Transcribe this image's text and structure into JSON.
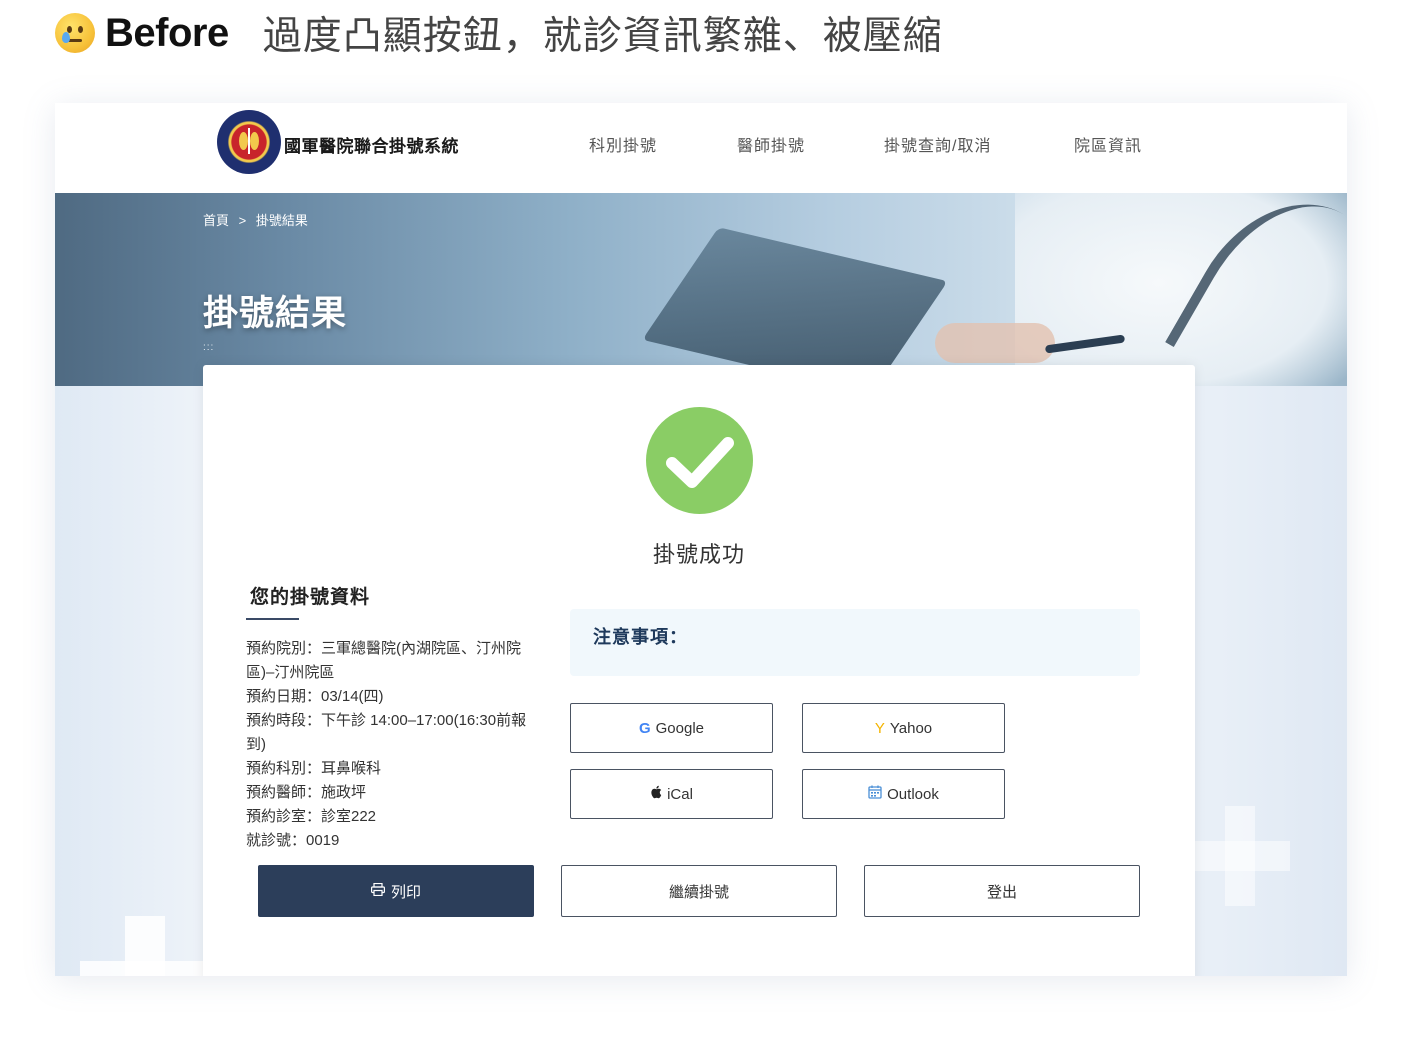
{
  "caption": {
    "emoji": "sad-tear-face",
    "before": "Before",
    "description": "過度凸顯按鈕，就診資訊繁雜、被壓縮"
  },
  "nav": {
    "brand": "國軍醫院聯合掛號系統",
    "items": [
      "科別掛號",
      "醫師掛號",
      "掛號查詢/取消",
      "院區資訊"
    ]
  },
  "hero": {
    "breadcrumb": [
      "首頁",
      ">",
      "掛號結果"
    ],
    "title": "掛號結果",
    "dots": ":::"
  },
  "result": {
    "status": "掛號成功"
  },
  "info": {
    "title": "您的掛號資料",
    "lines": [
      "預約院別：三軍總醫院(內湖院區、汀州院區)–汀州院區",
      "預約日期：03/14(四)",
      "預約時段：下午診 14:00–17:00(16:30前報到)",
      "預約科別：耳鼻喉科",
      "預約醫師：施政坪",
      "預約診室：診室222",
      "就診號：0019"
    ]
  },
  "notice": {
    "title": "注意事項："
  },
  "calendar": {
    "google": "Google",
    "yahoo": "Yahoo",
    "ical": "iCal",
    "outlook": "Outlook"
  },
  "actions": {
    "print": "列印",
    "continue": "繼續掛號",
    "logout": "登出"
  },
  "colors": {
    "primary": "#2c3e5a",
    "success": "#8acd65",
    "google": "#4285f4",
    "yahoo": "#f4b400",
    "outlook": "#4a8fd6"
  }
}
